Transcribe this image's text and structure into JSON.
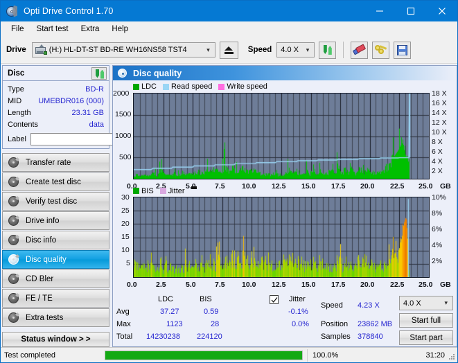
{
  "window": {
    "title": "Opti Drive Control 1.70",
    "icon": "disc-icon",
    "minimize": "minimize-icon",
    "maximize": "maximize-icon",
    "close": "close-icon"
  },
  "menu": {
    "items": [
      "File",
      "Start test",
      "Extra",
      "Help"
    ]
  },
  "toolbar": {
    "drive_label": "Drive",
    "drive_value": "(H:)  HL-DT-ST BD-RE  WH16NS58 TST4",
    "eject_icon": "eject-icon",
    "speed_label": "Speed",
    "speed_value": "4.0 X",
    "refresh_icon": "refresh-icon",
    "erase_icon": "eraser-icon",
    "keys_icon": "keys-icon",
    "save_icon": "save-icon"
  },
  "disc_panel": {
    "title": "Disc",
    "refresh_icon": "refresh-icon",
    "rows": [
      {
        "key": "Type",
        "value": "BD-R"
      },
      {
        "key": "MID",
        "value": "UMEBDR016 (000)"
      },
      {
        "key": "Length",
        "value": "23.31 GB"
      },
      {
        "key": "Contents",
        "value": "data"
      }
    ],
    "label_key": "Label",
    "label_value": "",
    "label_placeholder": "",
    "label_button_icon": "disc-icon"
  },
  "sidebar": {
    "items": [
      {
        "label": "Transfer rate",
        "active": false
      },
      {
        "label": "Create test disc",
        "active": false
      },
      {
        "label": "Verify test disc",
        "active": false
      },
      {
        "label": "Drive info",
        "active": false
      },
      {
        "label": "Disc info",
        "active": false
      },
      {
        "label": "Disc quality",
        "active": true
      },
      {
        "label": "CD Bler",
        "active": false
      },
      {
        "label": "FE / TE",
        "active": false
      },
      {
        "label": "Extra tests",
        "active": false
      }
    ],
    "status_window_button": "Status window > >"
  },
  "main": {
    "header_title": "Disc quality",
    "header_icon": "disc-quality-icon"
  },
  "chart_data": [
    {
      "type": "area",
      "name": "top-chart",
      "title": "Disc quality",
      "legend": [
        {
          "label": "LDC",
          "color": "#00b300"
        },
        {
          "label": "Read speed",
          "color": "#9ad6f5"
        },
        {
          "label": "Write speed",
          "color": "#ff6ee0"
        }
      ],
      "legend_position": "top-left",
      "xlabel": "GB",
      "xlim": [
        0.0,
        25.0
      ],
      "xticks": [
        "0.0",
        "2.5",
        "5.0",
        "7.5",
        "10.0",
        "12.5",
        "15.0",
        "17.5",
        "20.0",
        "22.5",
        "25.0"
      ],
      "ylabel_left": "LDC",
      "ylim_left": [
        0,
        2000
      ],
      "yticks_left": [
        "500",
        "1000",
        "1500",
        "2000"
      ],
      "ylabel_right": "Speed",
      "ylim_right": [
        0,
        18
      ],
      "yticks_right": [
        "2 X",
        "4 X",
        "6 X",
        "8 X",
        "10 X",
        "12 X",
        "14 X",
        "16 X",
        "18 X"
      ],
      "grid": true,
      "series": [
        {
          "name": "LDC",
          "color": "#00c000",
          "x_gb": [
            0.0,
            0.2,
            0.5,
            0.8,
            1.1,
            1.4,
            1.7,
            2.0,
            2.3,
            2.6,
            2.9,
            3.2,
            3.5,
            3.8,
            4.1,
            4.4,
            4.7,
            5.0,
            5.3,
            5.6,
            5.9,
            6.2,
            6.5,
            6.8,
            7.1,
            7.4,
            7.7,
            8.0,
            8.3,
            8.6,
            8.9,
            9.2,
            9.5,
            9.8,
            10.1,
            10.4,
            10.7,
            11.0,
            11.3,
            11.6,
            11.9,
            12.2,
            12.5,
            12.8,
            13.1,
            13.4,
            13.7,
            14.0,
            14.3,
            14.6,
            14.9,
            15.2,
            15.5,
            15.8,
            16.1,
            16.4,
            16.7,
            17.0,
            17.3,
            17.6,
            17.9,
            18.2,
            18.5,
            18.8,
            19.1,
            19.4,
            19.7,
            20.0,
            20.3,
            20.6,
            20.9,
            21.2,
            21.5,
            21.8,
            22.1,
            22.4,
            22.7,
            23.0,
            23.3
          ],
          "values": [
            60,
            120,
            110,
            90,
            140,
            95,
            210,
            100,
            300,
            140,
            110,
            130,
            170,
            120,
            230,
            160,
            190,
            150,
            240,
            200,
            180,
            260,
            210,
            300,
            240,
            190,
            470,
            230,
            400,
            270,
            210,
            480,
            260,
            230,
            300,
            200,
            170,
            150,
            140,
            130,
            190,
            125,
            160,
            135,
            300,
            150,
            320,
            145,
            130,
            290,
            140,
            380,
            150,
            300,
            170,
            150,
            400,
            130,
            470,
            150,
            330,
            180,
            420,
            150,
            380,
            210,
            300,
            250,
            200,
            170,
            260,
            300,
            420,
            560,
            730,
            900,
            1120,
            760,
            480
          ]
        },
        {
          "name": "Read speed",
          "color": "#9ad6f5",
          "x_gb": [
            0.0,
            1.5,
            1.6,
            3.2,
            3.3,
            5.0,
            5.1,
            6.8,
            6.9,
            8.5,
            8.6,
            10.3,
            10.4,
            12.0,
            12.1,
            13.8,
            13.9,
            15.5,
            15.6,
            17.2,
            17.3,
            19.0,
            19.1,
            20.8,
            20.9,
            22.4,
            22.5,
            23.3,
            23.35
          ],
          "values_x": [
            1.95,
            1.95,
            2.2,
            2.2,
            2.45,
            2.45,
            2.7,
            2.7,
            2.95,
            2.95,
            3.2,
            3.2,
            3.4,
            3.4,
            3.6,
            3.6,
            3.8,
            3.8,
            3.95,
            3.95,
            4.1,
            4.1,
            4.25,
            4.25,
            4.4,
            4.4,
            4.45,
            4.45,
            18.0
          ]
        }
      ]
    },
    {
      "type": "area",
      "name": "bottom-chart",
      "legend": [
        {
          "label": "BIS",
          "color": "#00b300"
        },
        {
          "label": "Jitter",
          "color": "#d9a8e0"
        }
      ],
      "legend_position": "top-left",
      "xlabel": "GB",
      "xlim": [
        0.0,
        25.0
      ],
      "xticks": [
        "0.0",
        "2.5",
        "5.0",
        "7.5",
        "10.0",
        "12.5",
        "15.0",
        "17.5",
        "20.0",
        "22.5",
        "25.0"
      ],
      "ylabel_left": "BIS",
      "ylim_left": [
        0,
        30
      ],
      "yticks_left": [
        "5",
        "10",
        "15",
        "20",
        "25",
        "30"
      ],
      "ylabel_right": "Jitter",
      "ylim_right": [
        0,
        10
      ],
      "yticks_right": [
        "2%",
        "4%",
        "6%",
        "8%",
        "10%"
      ],
      "grid": true,
      "series": [
        {
          "name": "BIS",
          "color": "#4ad400",
          "x_gb": [
            0.0,
            0.15,
            0.3,
            0.45,
            0.6,
            0.75,
            0.9,
            1.05,
            1.2,
            1.35,
            1.5,
            1.65,
            1.8,
            1.95,
            2.1,
            2.25,
            2.4,
            2.55,
            2.7,
            2.85,
            3.0,
            3.15,
            3.3,
            3.45,
            3.6,
            3.75,
            3.9,
            4.05,
            4.2,
            4.35,
            4.5,
            4.65,
            4.8,
            4.95,
            5.1,
            5.25,
            5.4,
            5.55,
            5.7,
            5.85,
            6.0,
            6.15,
            6.3,
            6.45,
            6.6,
            6.75,
            6.9,
            7.05,
            7.2,
            7.35,
            7.5,
            7.65,
            7.8,
            7.95,
            8.1,
            8.25,
            8.4,
            8.55,
            8.7,
            8.85,
            9.0,
            9.15,
            9.3,
            9.45,
            9.6,
            9.75,
            9.9,
            10.05,
            10.2,
            10.35,
            10.5,
            10.65,
            10.8,
            10.95,
            11.1,
            11.25,
            11.4,
            11.55,
            11.7,
            11.85,
            12.0,
            12.3,
            12.6,
            12.9,
            13.2,
            13.5,
            13.8,
            14.1,
            14.4,
            14.7,
            15.0,
            15.3,
            15.6,
            15.9,
            16.2,
            16.5,
            16.8,
            17.1,
            17.4,
            17.7,
            18.0,
            18.3,
            18.6,
            18.9,
            19.2,
            19.5,
            19.8,
            20.1,
            20.4,
            20.7,
            21.0,
            21.3,
            21.6,
            21.9,
            22.1,
            22.3,
            22.5,
            22.7,
            22.85,
            23.0,
            23.15,
            23.3
          ],
          "values": [
            9,
            6,
            5,
            7,
            4,
            6,
            3,
            5,
            4,
            6,
            9,
            4,
            3,
            5,
            4,
            9,
            3,
            4,
            10,
            3,
            4,
            5,
            3,
            4,
            5,
            3,
            4,
            5,
            3,
            9,
            4,
            5,
            3,
            4,
            5,
            8,
            4,
            3,
            9,
            5,
            4,
            6,
            5,
            8,
            4,
            6,
            5,
            9,
            13,
            6,
            5,
            9,
            7,
            12,
            6,
            9,
            5,
            7,
            6,
            8,
            5,
            7,
            15,
            6,
            9,
            5,
            11,
            6,
            8,
            5,
            7,
            4,
            8,
            5,
            6,
            4,
            7,
            5,
            6,
            4,
            5,
            6,
            5,
            7,
            5,
            6,
            4,
            8,
            5,
            6,
            5,
            9,
            4,
            7,
            5,
            6,
            4,
            5,
            10,
            4,
            5,
            6,
            5,
            9,
            4,
            10,
            5,
            6,
            4,
            5,
            6,
            5,
            8,
            10,
            10,
            11,
            14,
            19,
            25,
            28,
            22,
            3
          ]
        },
        {
          "name": "Jitter",
          "color": "#9ad6f5",
          "peak_x_gb": 23.3,
          "peak_value_pct": 9.8
        }
      ]
    }
  ],
  "stats": {
    "col_headers": [
      "LDC",
      "BIS"
    ],
    "rows": [
      {
        "label": "Avg",
        "ldc": "37.27",
        "bis": "0.59",
        "jitter": "-0.1%"
      },
      {
        "label": "Max",
        "ldc": "1123",
        "bis": "28",
        "jitter": "0.0%"
      },
      {
        "label": "Total",
        "ldc": "14230238",
        "bis": "224120",
        "jitter": ""
      }
    ],
    "jitter_label": "Jitter",
    "jitter_checked": true,
    "speed_label": "Speed",
    "speed_value": "4.23 X",
    "position_label": "Position",
    "position_value": "23862 MB",
    "samples_label": "Samples",
    "samples_value": "378840",
    "speed_select": "4.0 X",
    "start_full_button": "Start full",
    "start_part_button": "Start part"
  },
  "statusbar": {
    "message": "Test completed",
    "progress_percent": "100.0%",
    "progress_value": 100,
    "elapsed": "31:20"
  },
  "colors": {
    "titlebar": "#0579d3",
    "accent": "#2525d0",
    "plot_bg": "#6e7d98",
    "ldc_green": "#00c000",
    "read_speed": "#9ad6f5",
    "write_speed": "#ff6ee0",
    "jitter_lilac": "#d9a8e0",
    "progress_green": "#14a914"
  }
}
